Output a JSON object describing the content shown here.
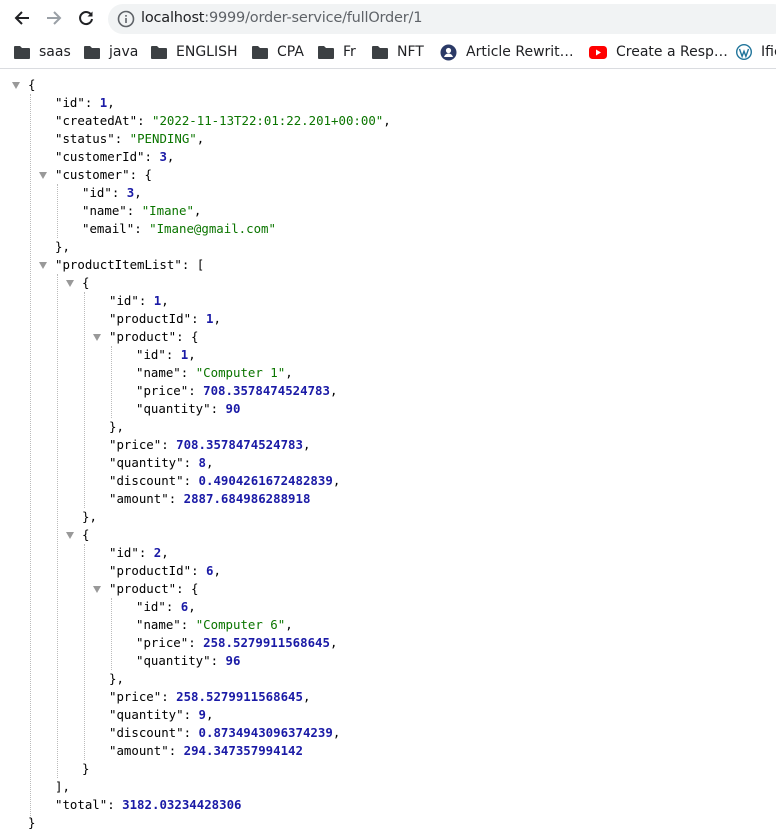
{
  "browser": {
    "url_host": "localhost",
    "url_rest": ":9999/order-service/fullOrder/1"
  },
  "bookmarks": [
    {
      "label": "saas",
      "icon": "folder-icon"
    },
    {
      "label": "java",
      "icon": "folder-icon"
    },
    {
      "label": "ENGLISH",
      "icon": "folder-icon"
    },
    {
      "label": "CPA",
      "icon": "folder-icon"
    },
    {
      "label": "Fr",
      "icon": "folder-icon"
    },
    {
      "label": "NFT",
      "icon": "folder-icon"
    },
    {
      "label": "Article Rewrit…",
      "icon": "article-rewriter-icon"
    },
    {
      "label": "Create a Resp…",
      "icon": "youtube-icon"
    },
    {
      "label": "Ific",
      "icon": "wordpress-icon"
    }
  ],
  "order": {
    "id": "1",
    "createdAt": "\"2022-11-13T22:01:22.201+00:00\"",
    "status": "\"PENDING\"",
    "customerId": "3",
    "customer": {
      "id": "3",
      "name": "\"Imane\"",
      "email": "\"Imane@gmail.com\""
    },
    "productItemList": [
      {
        "id": "1",
        "productId": "1",
        "product": {
          "id": "1",
          "name": "\"Computer 1\"",
          "price": "708.3578474524783",
          "quantity": "90"
        },
        "price": "708.3578474524783",
        "quantity": "8",
        "discount": "0.4904261672482839",
        "amount": "2887.684986288918"
      },
      {
        "id": "2",
        "productId": "6",
        "product": {
          "id": "6",
          "name": "\"Computer 6\"",
          "price": "258.5279911568645",
          "quantity": "96"
        },
        "price": "258.5279911568645",
        "quantity": "9",
        "discount": "0.8734943096374239",
        "amount": "294.347357994142"
      }
    ],
    "total": "3182.03234428306"
  }
}
